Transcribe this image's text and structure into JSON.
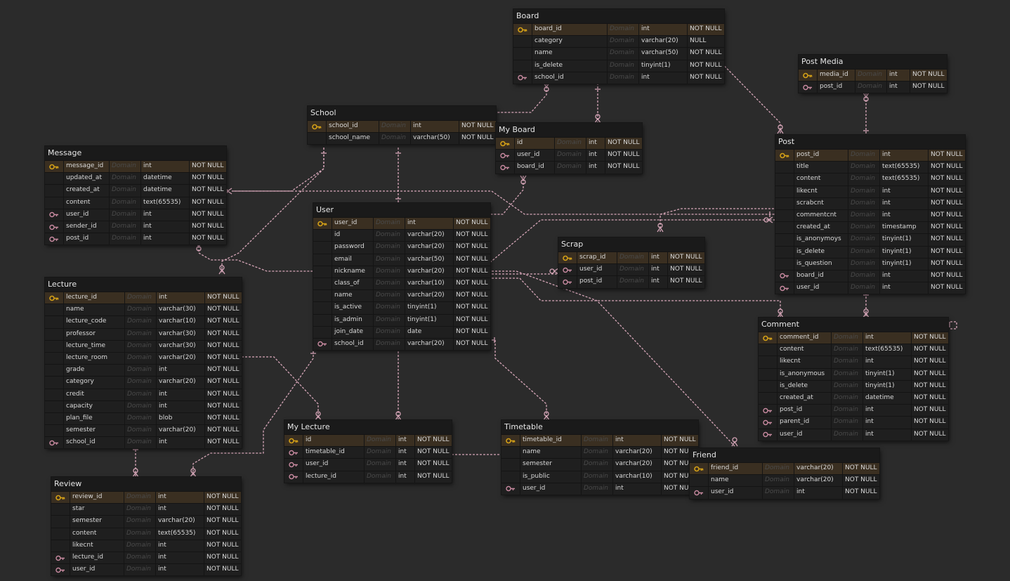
{
  "domain_label": "Domain",
  "colors": {
    "background": "#2b2b2b",
    "table": "#1f1f1f",
    "pk_row": "#3a2f21",
    "link": "#d6a6b8",
    "pk_key": "#d4a017",
    "fk_key": "#c88aa0"
  },
  "tables": [
    {
      "id": "board",
      "name": "Board",
      "cols": [
        {
          "key": "pk",
          "name": "board_id",
          "type": "int",
          "null": "NOT NULL"
        },
        {
          "key": "",
          "name": "category",
          "type": "varchar(20)",
          "null": "NULL"
        },
        {
          "key": "",
          "name": "name",
          "type": "varchar(50)",
          "null": "NOT NULL"
        },
        {
          "key": "",
          "name": "is_delete",
          "type": "tinyint(1)",
          "null": "NOT NULL"
        },
        {
          "key": "fk",
          "name": "school_id",
          "type": "int",
          "null": "NOT NULL"
        }
      ]
    },
    {
      "id": "post_media",
      "name": "Post Media",
      "cols": [
        {
          "key": "pk",
          "name": "media_id",
          "type": "int",
          "null": "NOT NULL"
        },
        {
          "key": "fk",
          "name": "post_id",
          "type": "int",
          "null": "NOT NULL"
        }
      ]
    },
    {
      "id": "school",
      "name": "School",
      "cols": [
        {
          "key": "pk",
          "name": "school_id",
          "type": "int",
          "null": "NOT NULL"
        },
        {
          "key": "",
          "name": "school_name",
          "type": "varchar(50)",
          "null": "NOT NULL"
        }
      ]
    },
    {
      "id": "my_board",
      "name": "My Board",
      "cols": [
        {
          "key": "pk",
          "name": "id",
          "type": "int",
          "null": "NOT NULL"
        },
        {
          "key": "fk",
          "name": "user_id",
          "type": "int",
          "null": "NOT NULL"
        },
        {
          "key": "fk",
          "name": "board_id",
          "type": "int",
          "null": "NOT NULL"
        }
      ]
    },
    {
      "id": "post",
      "name": "Post",
      "cols": [
        {
          "key": "pk",
          "name": "post_id",
          "type": "int",
          "null": "NOT NULL"
        },
        {
          "key": "",
          "name": "title",
          "type": "text(65535)",
          "null": "NOT NULL"
        },
        {
          "key": "",
          "name": "content",
          "type": "text(65535)",
          "null": "NOT NULL"
        },
        {
          "key": "",
          "name": "likecnt",
          "type": "int",
          "null": "NOT NULL"
        },
        {
          "key": "",
          "name": "scrabcnt",
          "type": "int",
          "null": "NOT NULL"
        },
        {
          "key": "",
          "name": "commentcnt",
          "type": "int",
          "null": "NOT NULL"
        },
        {
          "key": "",
          "name": "created_at",
          "type": "timestamp",
          "null": "NOT NULL"
        },
        {
          "key": "",
          "name": "is_anonymoys",
          "type": "tinyint(1)",
          "null": "NOT NULL"
        },
        {
          "key": "",
          "name": "is_delete",
          "type": "tinyint(1)",
          "null": "NOT NULL"
        },
        {
          "key": "",
          "name": "is_question",
          "type": "tinyint(1)",
          "null": "NOT NULL"
        },
        {
          "key": "fk",
          "name": "board_id",
          "type": "int",
          "null": "NOT NULL"
        },
        {
          "key": "fk",
          "name": "user_id",
          "type": "int",
          "null": "NOT NULL"
        }
      ]
    },
    {
      "id": "message",
      "name": "Message",
      "cols": [
        {
          "key": "pk",
          "name": "message_id",
          "type": "int",
          "null": "NOT NULL"
        },
        {
          "key": "",
          "name": "updated_at",
          "type": "datetime",
          "null": "NOT NULL"
        },
        {
          "key": "",
          "name": "created_at",
          "type": "datetime",
          "null": "NOT NULL"
        },
        {
          "key": "",
          "name": "content",
          "type": "text(65535)",
          "null": "NOT NULL"
        },
        {
          "key": "fk",
          "name": "user_id",
          "type": "int",
          "null": "NOT NULL"
        },
        {
          "key": "fk",
          "name": "sender_id",
          "type": "int",
          "null": "NOT NULL"
        },
        {
          "key": "fk",
          "name": "post_id",
          "type": "int",
          "null": "NOT NULL"
        }
      ]
    },
    {
      "id": "user",
      "name": "User",
      "cols": [
        {
          "key": "pk",
          "name": "user_id",
          "type": "int",
          "null": "NOT NULL"
        },
        {
          "key": "",
          "name": "id",
          "type": "varchar(20)",
          "null": "NOT NULL"
        },
        {
          "key": "",
          "name": "password",
          "type": "varchar(20)",
          "null": "NOT NULL"
        },
        {
          "key": "",
          "name": "email",
          "type": "varchar(50)",
          "null": "NOT NULL"
        },
        {
          "key": "",
          "name": "nickname",
          "type": "varchar(20)",
          "null": "NOT NULL"
        },
        {
          "key": "",
          "name": "class_of",
          "type": "varchar(10)",
          "null": "NOT NULL"
        },
        {
          "key": "",
          "name": "name",
          "type": "varchar(20)",
          "null": "NOT NULL"
        },
        {
          "key": "",
          "name": "is_active",
          "type": "tinyint(1)",
          "null": "NOT NULL"
        },
        {
          "key": "",
          "name": "is_admin",
          "type": "tinyint(1)",
          "null": "NOT NULL"
        },
        {
          "key": "",
          "name": "join_date",
          "type": "date",
          "null": "NOT NULL"
        },
        {
          "key": "fk",
          "name": "school_id",
          "type": "varchar(20)",
          "null": "NOT NULL"
        }
      ]
    },
    {
      "id": "scrap",
      "name": "Scrap",
      "cols": [
        {
          "key": "pk",
          "name": "scrap_id",
          "type": "int",
          "null": "NOT NULL"
        },
        {
          "key": "fk",
          "name": "user_id",
          "type": "int",
          "null": "NOT NULL"
        },
        {
          "key": "fk",
          "name": "post_id",
          "type": "int",
          "null": "NOT NULL"
        }
      ]
    },
    {
      "id": "lecture",
      "name": "Lecture",
      "cols": [
        {
          "key": "pk",
          "name": "lecture_id",
          "type": "int",
          "null": "NOT NULL"
        },
        {
          "key": "",
          "name": "name",
          "type": "varchar(30)",
          "null": "NOT NULL"
        },
        {
          "key": "",
          "name": "lecture_code",
          "type": "varchar(10)",
          "null": "NOT NULL"
        },
        {
          "key": "",
          "name": "professor",
          "type": "varchar(30)",
          "null": "NOT NULL"
        },
        {
          "key": "",
          "name": "lecture_time",
          "type": "varchar(30)",
          "null": "NOT NULL"
        },
        {
          "key": "",
          "name": "lecture_room",
          "type": "varchar(20)",
          "null": "NOT NULL"
        },
        {
          "key": "",
          "name": "grade",
          "type": "int",
          "null": "NOT NULL"
        },
        {
          "key": "",
          "name": "category",
          "type": "varchar(20)",
          "null": "NOT NULL"
        },
        {
          "key": "",
          "name": "credit",
          "type": "int",
          "null": "NOT NULL"
        },
        {
          "key": "",
          "name": "capacity",
          "type": "int",
          "null": "NOT NULL"
        },
        {
          "key": "",
          "name": "plan_file",
          "type": "blob",
          "null": "NOT NULL"
        },
        {
          "key": "",
          "name": "semester",
          "type": "varchar(20)",
          "null": "NOT NULL"
        },
        {
          "key": "fk",
          "name": "school_id",
          "type": "int",
          "null": "NOT NULL"
        }
      ]
    },
    {
      "id": "comment",
      "name": "Comment",
      "cols": [
        {
          "key": "pk",
          "name": "comment_id",
          "type": "int",
          "null": "NOT NULL"
        },
        {
          "key": "",
          "name": "content",
          "type": "text(65535)",
          "null": "NOT NULL"
        },
        {
          "key": "",
          "name": "likecnt",
          "type": "int",
          "null": "NOT NULL"
        },
        {
          "key": "",
          "name": "is_anonymous",
          "type": "tinyint(1)",
          "null": "NOT NULL"
        },
        {
          "key": "",
          "name": "is_delete",
          "type": "tinyint(1)",
          "null": "NOT NULL"
        },
        {
          "key": "",
          "name": "created_at",
          "type": "datetime",
          "null": "NOT NULL"
        },
        {
          "key": "fk",
          "name": "post_id",
          "type": "int",
          "null": "NOT NULL"
        },
        {
          "key": "fk",
          "name": "parent_id",
          "type": "int",
          "null": "NOT NULL"
        },
        {
          "key": "fk",
          "name": "user_id",
          "type": "int",
          "null": "NOT NULL"
        }
      ]
    },
    {
      "id": "my_lecture",
      "name": "My Lecture",
      "cols": [
        {
          "key": "pk",
          "name": "id",
          "type": "int",
          "null": "NOT NULL"
        },
        {
          "key": "fk",
          "name": "timetable_id",
          "type": "int",
          "null": "NOT NULL"
        },
        {
          "key": "fk",
          "name": "user_id",
          "type": "int",
          "null": "NOT NULL"
        },
        {
          "key": "fk",
          "name": "lecture_id",
          "type": "int",
          "null": "NOT NULL"
        }
      ]
    },
    {
      "id": "timetable",
      "name": "Timetable",
      "cols": [
        {
          "key": "pk",
          "name": "timetable_id",
          "type": "int",
          "null": "NOT NULL"
        },
        {
          "key": "",
          "name": "name",
          "type": "varchar(20)",
          "null": "NOT NULL"
        },
        {
          "key": "",
          "name": "semester",
          "type": "varchar(20)",
          "null": "NOT NULL"
        },
        {
          "key": "",
          "name": "is_public",
          "type": "varchar(10)",
          "null": "NOT NULL"
        },
        {
          "key": "fk",
          "name": "user_id",
          "type": "int",
          "null": "NOT NULL"
        }
      ]
    },
    {
      "id": "friend",
      "name": "Friend",
      "cols": [
        {
          "key": "pk",
          "name": "friend_id",
          "type": "varchar(20)",
          "null": "NOT NULL"
        },
        {
          "key": "",
          "name": "name",
          "type": "varchar(20)",
          "null": "NOT NULL"
        },
        {
          "key": "fk",
          "name": "user_id",
          "type": "int",
          "null": "NOT NULL"
        }
      ]
    },
    {
      "id": "review",
      "name": "Review",
      "cols": [
        {
          "key": "pk",
          "name": "review_id",
          "type": "int",
          "null": "NOT NULL"
        },
        {
          "key": "",
          "name": "star",
          "type": "int",
          "null": "NOT NULL"
        },
        {
          "key": "",
          "name": "semester",
          "type": "varchar(20)",
          "null": "NOT NULL"
        },
        {
          "key": "",
          "name": "content",
          "type": "text(65535)",
          "null": "NOT NULL"
        },
        {
          "key": "",
          "name": "likecnt",
          "type": "int",
          "null": "NOT NULL"
        },
        {
          "key": "fk",
          "name": "lecture_id",
          "type": "int",
          "null": "NOT NULL"
        },
        {
          "key": "fk",
          "name": "user_id",
          "type": "int",
          "null": "NOT NULL"
        }
      ]
    }
  ]
}
